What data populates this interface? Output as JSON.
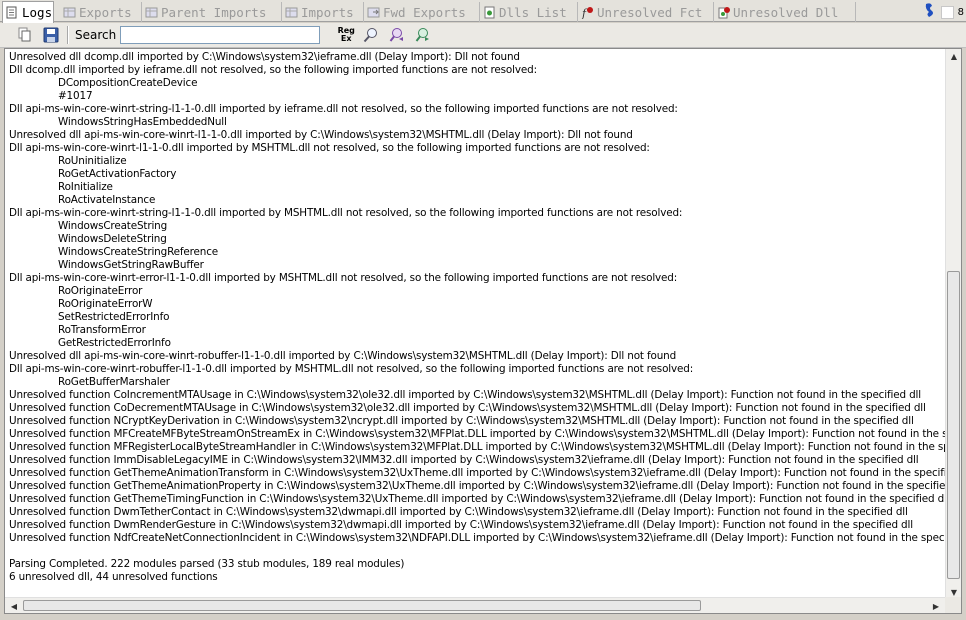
{
  "tabs": [
    {
      "label": "Logs",
      "icon": "logs-icon"
    },
    {
      "label": "Exports",
      "icon": "exports-icon"
    },
    {
      "label": "Parent Imports",
      "icon": "parent-imports-icon"
    },
    {
      "label": "Imports",
      "icon": "imports-icon"
    },
    {
      "label": "Fwd Exports",
      "icon": "fwd-exports-icon"
    },
    {
      "label": "Dlls List",
      "icon": "dlls-list-icon"
    },
    {
      "label": "Unresolved Fct",
      "icon": "unresolved-fct-icon"
    },
    {
      "label": "Unresolved Dll",
      "icon": "unresolved-dll-icon"
    }
  ],
  "page_indicator": "8",
  "toolbar": {
    "search_label": "Search",
    "search_value": "",
    "regex_line1": "Reg",
    "regex_line2": "Ex"
  },
  "log": {
    "lines": [
      {
        "text": "Unresolved dll dcomp.dll imported by C:\\Windows\\system32\\ieframe.dll (Delay Import): Dll not found",
        "indent": false
      },
      {
        "text": "Dll dcomp.dll imported by ieframe.dll not resolved, so the following imported functions are not resolved:",
        "indent": false
      },
      {
        "text": "DCompositionCreateDevice",
        "indent": true
      },
      {
        "text": "#1017",
        "indent": true
      },
      {
        "text": "Dll api-ms-win-core-winrt-string-l1-1-0.dll imported by ieframe.dll not resolved, so the following imported functions are not resolved:",
        "indent": false
      },
      {
        "text": "WindowsStringHasEmbeddedNull",
        "indent": true
      },
      {
        "text": "Unresolved dll api-ms-win-core-winrt-l1-1-0.dll imported by C:\\Windows\\system32\\MSHTML.dll (Delay Import): Dll not found",
        "indent": false
      },
      {
        "text": "Dll api-ms-win-core-winrt-l1-1-0.dll imported by MSHTML.dll not resolved, so the following imported functions are not resolved:",
        "indent": false
      },
      {
        "text": "RoUninitialize",
        "indent": true
      },
      {
        "text": "RoGetActivationFactory",
        "indent": true
      },
      {
        "text": "RoInitialize",
        "indent": true
      },
      {
        "text": "RoActivateInstance",
        "indent": true
      },
      {
        "text": "Dll api-ms-win-core-winrt-string-l1-1-0.dll imported by MSHTML.dll not resolved, so the following imported functions are not resolved:",
        "indent": false
      },
      {
        "text": "WindowsCreateString",
        "indent": true
      },
      {
        "text": "WindowsDeleteString",
        "indent": true
      },
      {
        "text": "WindowsCreateStringReference",
        "indent": true
      },
      {
        "text": "WindowsGetStringRawBuffer",
        "indent": true
      },
      {
        "text": "Dll api-ms-win-core-winrt-error-l1-1-0.dll imported by MSHTML.dll not resolved, so the following imported functions are not resolved:",
        "indent": false
      },
      {
        "text": "RoOriginateError",
        "indent": true
      },
      {
        "text": "RoOriginateErrorW",
        "indent": true
      },
      {
        "text": "SetRestrictedErrorInfo",
        "indent": true
      },
      {
        "text": "RoTransformError",
        "indent": true
      },
      {
        "text": "GetRestrictedErrorInfo",
        "indent": true
      },
      {
        "text": "Unresolved dll api-ms-win-core-winrt-robuffer-l1-1-0.dll imported by C:\\Windows\\system32\\MSHTML.dll (Delay Import): Dll not found",
        "indent": false
      },
      {
        "text": "Dll api-ms-win-core-winrt-robuffer-l1-1-0.dll imported by MSHTML.dll not resolved, so the following imported functions are not resolved:",
        "indent": false
      },
      {
        "text": "RoGetBufferMarshaler",
        "indent": true
      },
      {
        "text": "Unresolved function CoIncrementMTAUsage in C:\\Windows\\system32\\ole32.dll imported by C:\\Windows\\system32\\MSHTML.dll (Delay Import): Function not found in the specified dll",
        "indent": false
      },
      {
        "text": "Unresolved function CoDecrementMTAUsage in C:\\Windows\\system32\\ole32.dll imported by C:\\Windows\\system32\\MSHTML.dll (Delay Import): Function not found in the specified dll",
        "indent": false
      },
      {
        "text": "Unresolved function NCryptKeyDerivation in C:\\Windows\\system32\\ncrypt.dll imported by C:\\Windows\\system32\\MSHTML.dll (Delay Import): Function not found in the specified dll",
        "indent": false
      },
      {
        "text": "Unresolved function MFCreateMFByteStreamOnStreamEx in C:\\Windows\\system32\\MFPlat.DLL imported by C:\\Windows\\system32\\MSHTML.dll (Delay Import): Function not found in the specified",
        "indent": false
      },
      {
        "text": "Unresolved function MFRegisterLocalByteStreamHandler in C:\\Windows\\system32\\MFPlat.DLL imported by C:\\Windows\\system32\\MSHTML.dll (Delay Import): Function not found in the specified d",
        "indent": false
      },
      {
        "text": "Unresolved function ImmDisableLegacyIME in C:\\Windows\\system32\\IMM32.dll imported by C:\\Windows\\system32\\ieframe.dll (Delay Import): Function not found in the specified dll",
        "indent": false
      },
      {
        "text": "Unresolved function GetThemeAnimationTransform in C:\\Windows\\system32\\UxTheme.dll imported by C:\\Windows\\system32\\ieframe.dll (Delay Import): Function not found in the specified dll",
        "indent": false
      },
      {
        "text": "Unresolved function GetThemeAnimationProperty in C:\\Windows\\system32\\UxTheme.dll imported by C:\\Windows\\system32\\ieframe.dll (Delay Import): Function not found in the specified dll",
        "indent": false
      },
      {
        "text": "Unresolved function GetThemeTimingFunction in C:\\Windows\\system32\\UxTheme.dll imported by C:\\Windows\\system32\\ieframe.dll (Delay Import): Function not found in the specified dll",
        "indent": false
      },
      {
        "text": "Unresolved function DwmTetherContact in C:\\Windows\\system32\\dwmapi.dll imported by C:\\Windows\\system32\\ieframe.dll (Delay Import): Function not found in the specified dll",
        "indent": false
      },
      {
        "text": "Unresolved function DwmRenderGesture in C:\\Windows\\system32\\dwmapi.dll imported by C:\\Windows\\system32\\ieframe.dll (Delay Import): Function not found in the specified dll",
        "indent": false
      },
      {
        "text": "Unresolved function NdfCreateNetConnectionIncident in C:\\Windows\\system32\\NDFAPI.DLL imported by C:\\Windows\\system32\\ieframe.dll (Delay Import): Function not found in the specified dll",
        "indent": false
      },
      {
        "text": "",
        "indent": false
      },
      {
        "text": "Parsing Completed. 222 modules parsed (33 stub modules, 189 real modules)",
        "indent": false
      },
      {
        "text": "6 unresolved dll, 44 unresolved functions",
        "indent": false
      }
    ]
  },
  "colors": {
    "accent_blue": "#1f5fbf",
    "error_red": "#c01818"
  }
}
